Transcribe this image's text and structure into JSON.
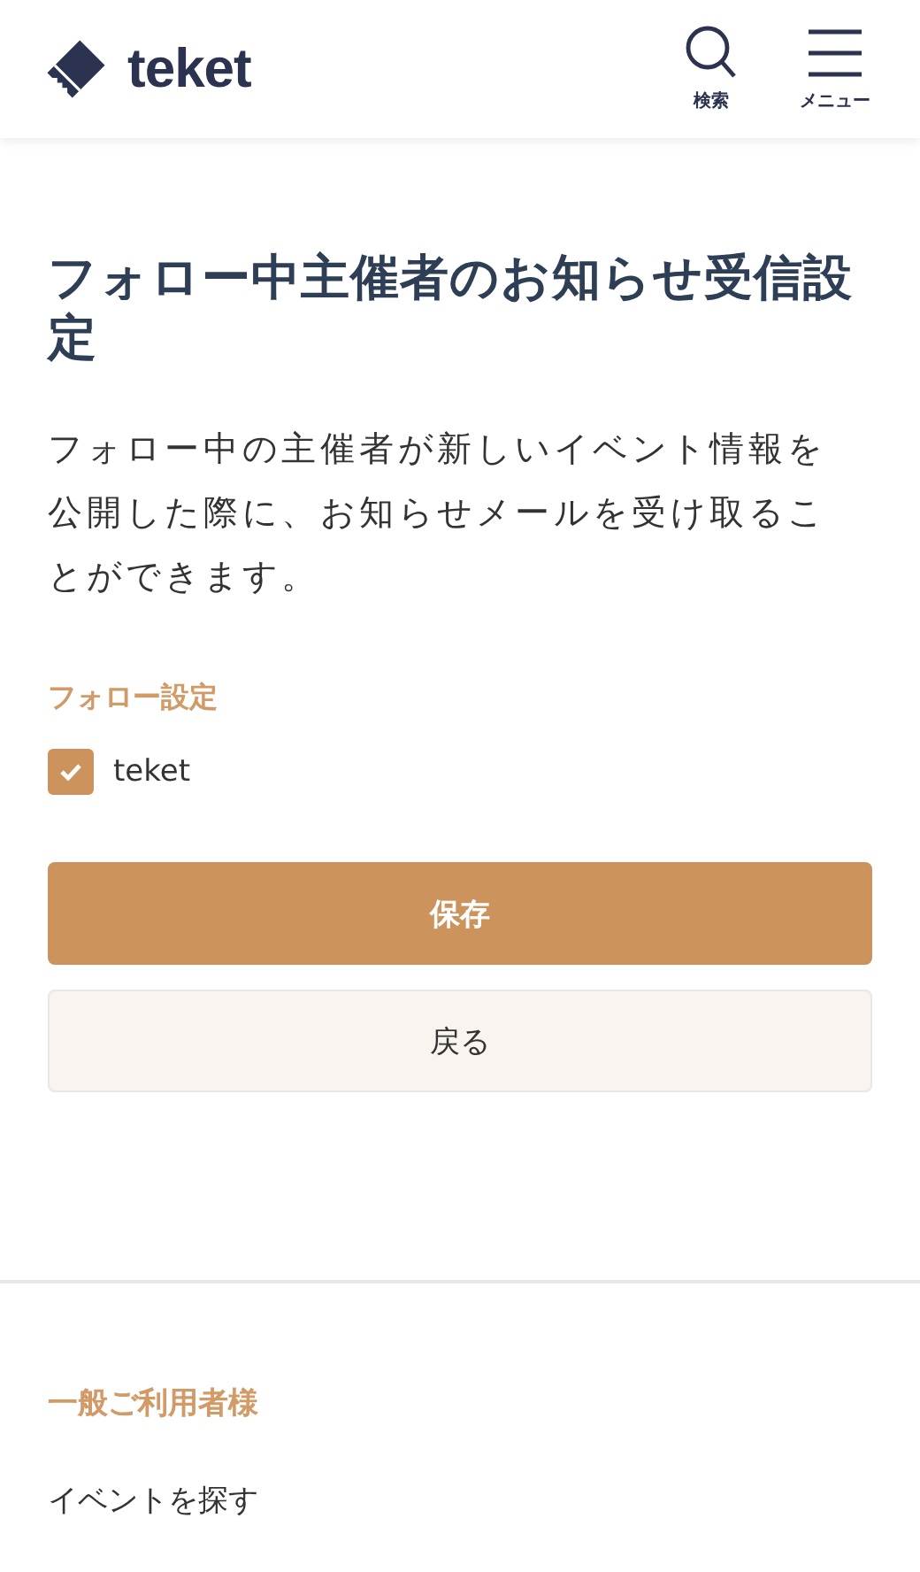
{
  "header": {
    "logo": "teket",
    "actions": [
      {
        "kind": "search",
        "label": "検索"
      },
      {
        "kind": "menu",
        "label": "メニュー"
      }
    ]
  },
  "title": "フォロー中主催者のお知らせ受信設定",
  "description": "フォロー中の主催者が新しいイベント情報を公開した際に、お知らせメールを受け取ることができます。",
  "section_label": "フォロー設定",
  "follows": [
    {
      "label": "teket",
      "checked": true
    }
  ],
  "buttons": [
    {
      "kind": "primary",
      "label": "保存"
    },
    {
      "kind": "secondary",
      "label": "戻る"
    }
  ],
  "footer": {
    "heading": "一般ご利用者様",
    "links": [
      "イベントを探す"
    ]
  }
}
